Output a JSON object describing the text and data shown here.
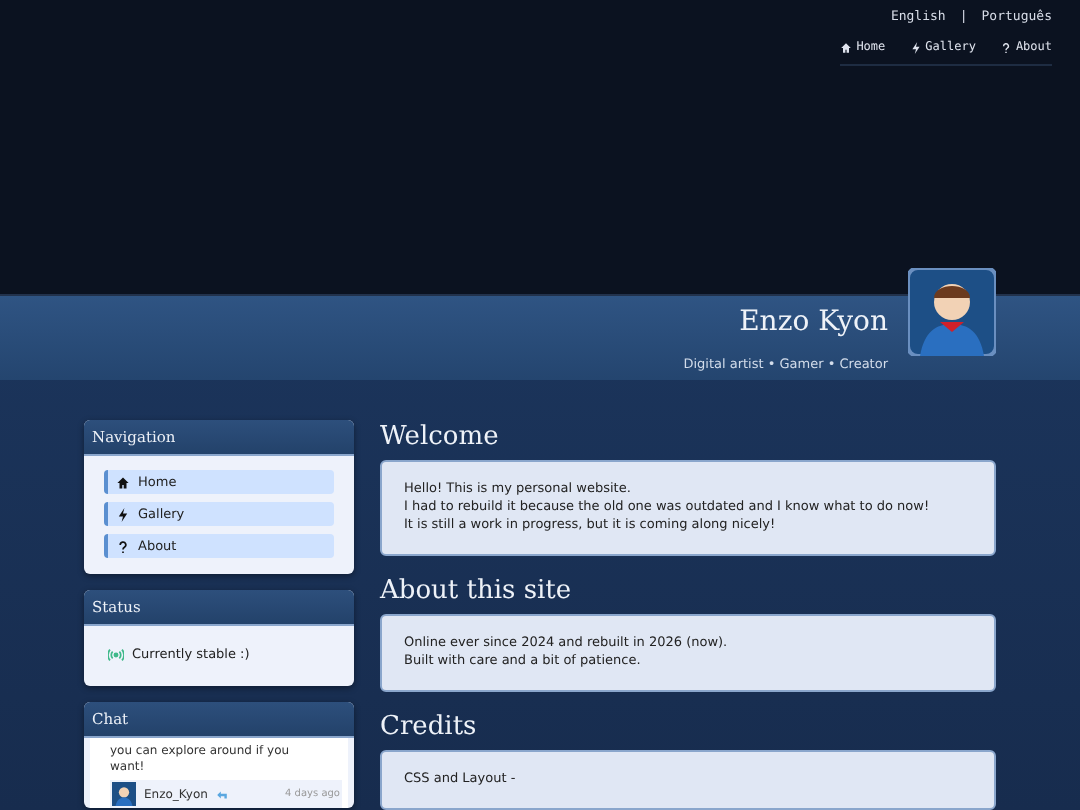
{
  "languages": [
    "English",
    "Português"
  ],
  "language_separator": "|",
  "top_nav": [
    {
      "label": "Home",
      "kind": "home"
    },
    {
      "label": "Gallery",
      "kind": "bolt"
    },
    {
      "label": "About",
      "kind": "question"
    }
  ],
  "profile": {
    "name": "Enzo Kyon",
    "tagline": "Digital artist • Gamer • Creator"
  },
  "sidebar": {
    "navigation": {
      "title": "Navigation",
      "items": [
        {
          "label": "Home",
          "kind": "home"
        },
        {
          "label": "Gallery",
          "kind": "bolt"
        },
        {
          "label": "About",
          "kind": "question"
        }
      ]
    },
    "status": {
      "title": "Status",
      "text": "Currently stable :)"
    },
    "chat": {
      "title": "Chat",
      "messages": [
        {
          "text": "you can explore around if you want!"
        },
        {
          "user": "Enzo_Kyon",
          "time": "4 days ago"
        }
      ]
    }
  },
  "sections": [
    {
      "title": "Welcome",
      "lines": [
        "Hello! This is my personal website.",
        "I had to rebuild it because the old one was outdated and I know what to do now!",
        "It is still a work in progress, but it is coming along nicely!"
      ]
    },
    {
      "title": "About this site",
      "lines": [
        "Online ever since 2024 and rebuilt in 2026 (now).",
        "Built with care and a bit of patience."
      ]
    },
    {
      "title": "Credits",
      "lines": [
        "CSS and Layout -"
      ]
    }
  ]
}
